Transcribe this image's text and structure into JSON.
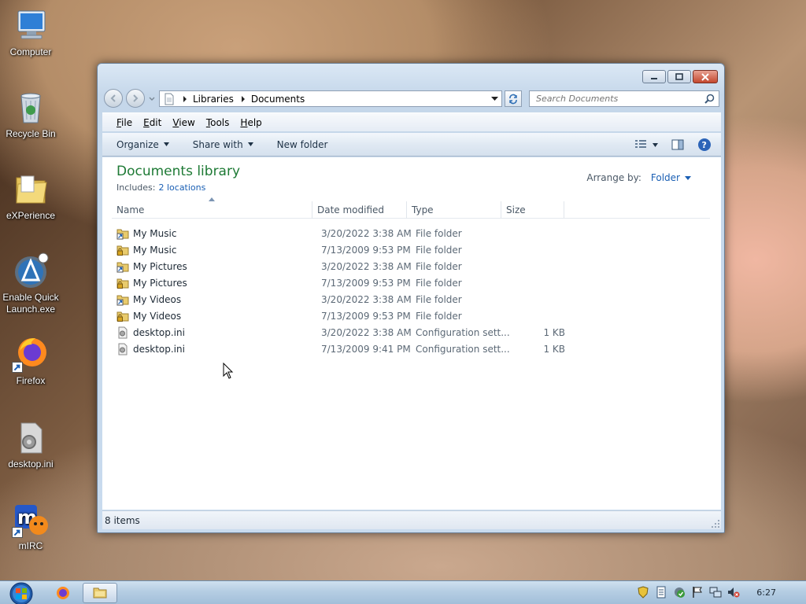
{
  "desktop": {
    "icons": [
      {
        "label": "Computer",
        "icon": "computer-icon"
      },
      {
        "label": "Recycle Bin",
        "icon": "recycle-bin-icon"
      },
      {
        "label": "eXPerience",
        "icon": "folder-icon"
      },
      {
        "label": "Enable Quick Launch.exe",
        "icon": "quick-launch-app-icon"
      },
      {
        "label": "Firefox",
        "icon": "firefox-icon"
      },
      {
        "label": "desktop.ini",
        "icon": "settings-file-icon"
      },
      {
        "label": "mIRC",
        "icon": "mirc-icon"
      }
    ]
  },
  "window": {
    "breadcrumb": [
      "Libraries",
      "Documents"
    ],
    "search_placeholder": "Search Documents",
    "menu": [
      "File",
      "Edit",
      "View",
      "Tools",
      "Help"
    ],
    "toolbar": {
      "organize": "Organize",
      "share_with": "Share with",
      "new_folder": "New folder"
    },
    "library": {
      "title": "Documents library",
      "includes_label": "Includes:",
      "includes_link": "2 locations",
      "arrange_label": "Arrange by:",
      "arrange_value": "Folder"
    },
    "columns": [
      "Name",
      "Date modified",
      "Type",
      "Size"
    ],
    "files": [
      {
        "name": "My Music",
        "date": "3/20/2022 3:38 AM",
        "type": "File folder",
        "size": "",
        "icon": "shortcut-folder-icon"
      },
      {
        "name": "My Music",
        "date": "7/13/2009 9:53 PM",
        "type": "File folder",
        "size": "",
        "icon": "locked-folder-icon"
      },
      {
        "name": "My Pictures",
        "date": "3/20/2022 3:38 AM",
        "type": "File folder",
        "size": "",
        "icon": "shortcut-folder-icon"
      },
      {
        "name": "My Pictures",
        "date": "7/13/2009 9:53 PM",
        "type": "File folder",
        "size": "",
        "icon": "locked-folder-icon"
      },
      {
        "name": "My Videos",
        "date": "3/20/2022 3:38 AM",
        "type": "File folder",
        "size": "",
        "icon": "shortcut-folder-icon"
      },
      {
        "name": "My Videos",
        "date": "7/13/2009 9:53 PM",
        "type": "File folder",
        "size": "",
        "icon": "locked-folder-icon"
      },
      {
        "name": "desktop.ini",
        "date": "3/20/2022 3:38 AM",
        "type": "Configuration sett...",
        "size": "1 KB",
        "icon": "settings-file-icon"
      },
      {
        "name": "desktop.ini",
        "date": "7/13/2009 9:41 PM",
        "type": "Configuration sett...",
        "size": "1 KB",
        "icon": "settings-file-icon"
      }
    ],
    "status": "8 items"
  },
  "taskbar": {
    "clock": "6:27"
  },
  "colors": {
    "library_title": "#1e7a35",
    "link": "#1a5fb4"
  }
}
